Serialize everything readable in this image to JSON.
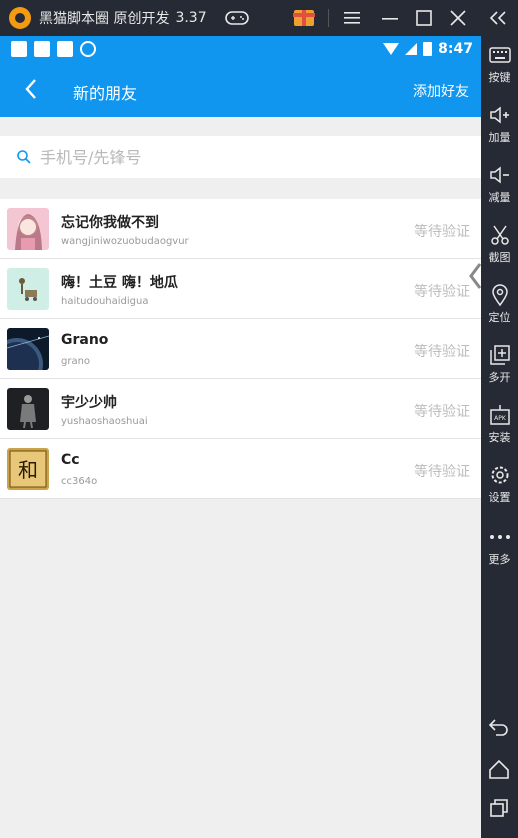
{
  "titlebar": {
    "app_title": "黑猫脚本圈 原创开发",
    "version": "3.37"
  },
  "statusbar": {
    "time": "8:47"
  },
  "appbar": {
    "title": "新的朋友",
    "action_label": "添加好友"
  },
  "search": {
    "placeholder": "手机号/先锋号",
    "value": ""
  },
  "friends": [
    {
      "name": "忘记你我做不到",
      "id": "wangjiniwozuobudaogvur",
      "status": "等待验证",
      "avatar": "avatar-girl"
    },
    {
      "name": "嗨！土豆 嗨！地瓜",
      "id": "haitudouhaidigua",
      "status": "等待验证",
      "avatar": "avatar-cart"
    },
    {
      "name": "Grano",
      "id": "grano",
      "status": "等待验证",
      "avatar": "avatar-planet"
    },
    {
      "name": "宇少少帅",
      "id": "yushaoshaoshuai",
      "status": "等待验证",
      "avatar": "avatar-knight"
    },
    {
      "name": "Cc",
      "id": "cc364o",
      "status": "等待验证",
      "avatar": "avatar-seal"
    }
  ],
  "toolbar": [
    {
      "label": "按键",
      "icon": "keyboard-icon"
    },
    {
      "label": "加量",
      "icon": "volume-up-icon"
    },
    {
      "label": "减量",
      "icon": "volume-down-icon"
    },
    {
      "label": "截图",
      "icon": "scissors-icon"
    },
    {
      "label": "定位",
      "icon": "location-icon"
    },
    {
      "label": "多开",
      "icon": "multi-open-icon"
    },
    {
      "label": "安装",
      "icon": "apk-install-icon"
    },
    {
      "label": "设置",
      "icon": "gear-icon"
    },
    {
      "label": "更多",
      "icon": "more-icon"
    }
  ],
  "colors": {
    "primary": "#1196f0",
    "emulator_bg": "#262a35",
    "page_bg": "#efefef",
    "status_text": "#bdbdbd"
  }
}
